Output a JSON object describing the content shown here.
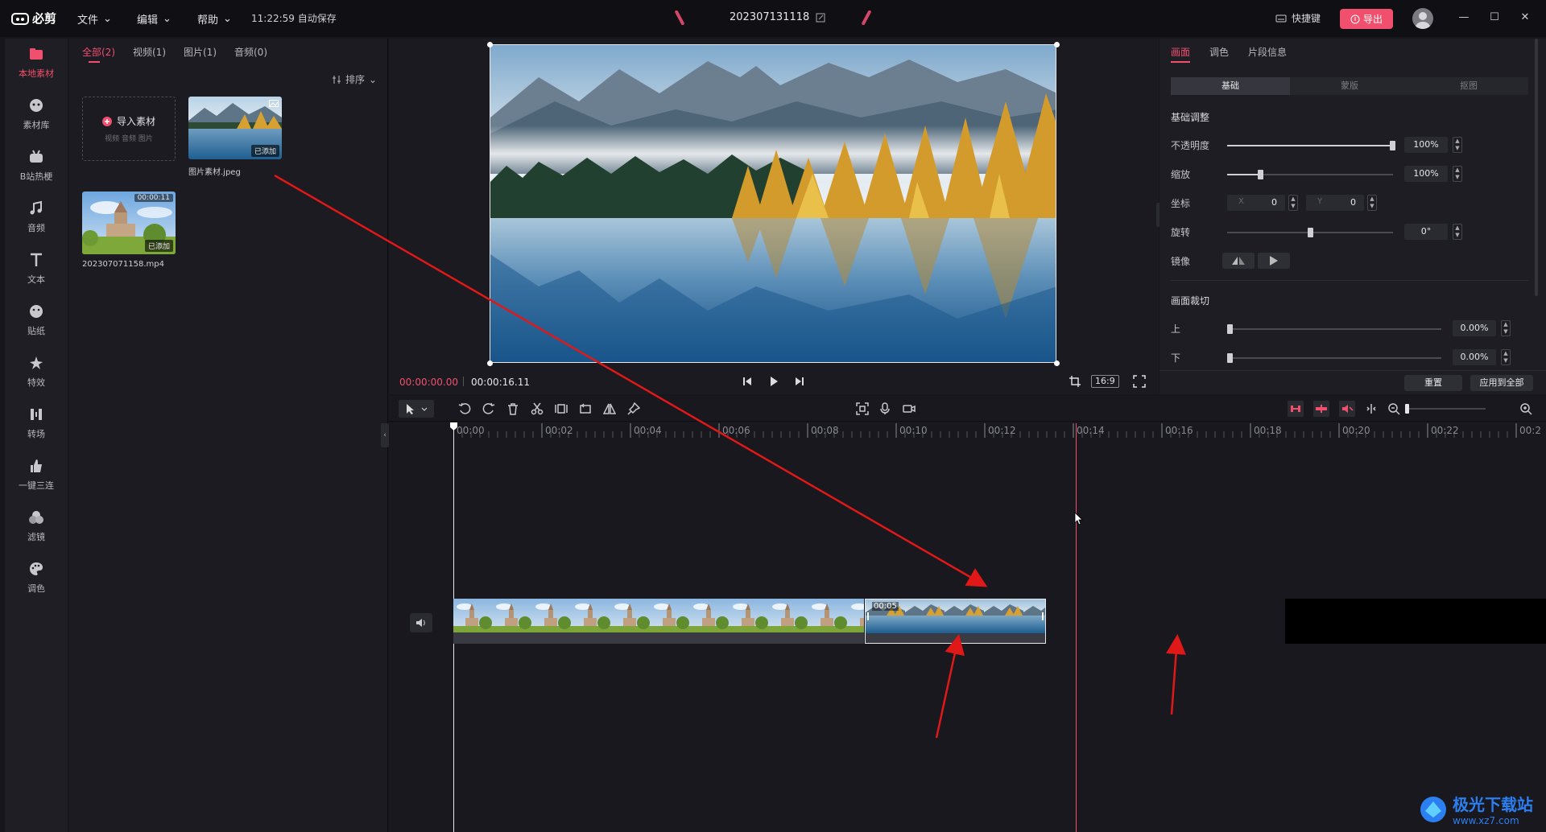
{
  "app": {
    "name": "必剪",
    "autosave": "11:22:59 自动保存",
    "project_title": "202307131118"
  },
  "menu": [
    {
      "label": "文件"
    },
    {
      "label": "编辑"
    },
    {
      "label": "帮助"
    }
  ],
  "topbar": {
    "shortcut_label": "快捷键",
    "export_label": "导出",
    "accent": "#f0506e"
  },
  "sidebar": {
    "items": [
      {
        "label": "本地素材",
        "icon": "folder-icon",
        "active": true
      },
      {
        "label": "素材库",
        "icon": "library-icon"
      },
      {
        "label": "B站热梗",
        "icon": "tv-icon"
      },
      {
        "label": "音频",
        "icon": "music-icon"
      },
      {
        "label": "文本",
        "icon": "text-icon"
      },
      {
        "label": "贴纸",
        "icon": "sticker-icon"
      },
      {
        "label": "特效",
        "icon": "effect-icon"
      },
      {
        "label": "转场",
        "icon": "transition-icon"
      },
      {
        "label": "一键三连",
        "icon": "thumb-up-icon"
      },
      {
        "label": "滤镜",
        "icon": "filter-icon"
      },
      {
        "label": "调色",
        "icon": "palette-icon"
      }
    ]
  },
  "media": {
    "tabs": [
      {
        "label": "全部(2)",
        "active": true
      },
      {
        "label": "视频(1)"
      },
      {
        "label": "图片(1)"
      },
      {
        "label": "音频(0)"
      }
    ],
    "sort_label": "排序",
    "import": {
      "label": "导入素材",
      "sub": "视频 音频 图片"
    },
    "items": [
      {
        "name": "图片素材.jpeg",
        "badge": "已添加"
      },
      {
        "name": "202307071158.mp4",
        "badge": "已添加",
        "duration": "00:00:11"
      }
    ]
  },
  "preview": {
    "current_time": "00:00:00.00",
    "total_time": "00:00:16.11",
    "ratio": "16:9"
  },
  "properties": {
    "tabs": [
      {
        "label": "画面",
        "active": true
      },
      {
        "label": "调色"
      },
      {
        "label": "片段信息"
      }
    ],
    "segments": [
      {
        "label": "基础",
        "active": true
      },
      {
        "label": "蒙版"
      },
      {
        "label": "抠图"
      }
    ],
    "basic_title": "基础调整",
    "opacity": {
      "label": "不透明度",
      "value": "100%",
      "level": 1.0
    },
    "scale": {
      "label": "缩放",
      "value": "100%",
      "level": 0.2
    },
    "position": {
      "label": "坐标",
      "x_label": "X",
      "x": "0",
      "y_label": "Y",
      "y": "0"
    },
    "rotation": {
      "label": "旋转",
      "value": "0°",
      "level": 0.5
    },
    "mirror": {
      "label": "镜像"
    },
    "crop_title": "画面裁切",
    "crop_top": {
      "label": "上",
      "value": "0.00%"
    },
    "crop_bottom": {
      "label": "下",
      "value": "0.00%"
    },
    "reset_label": "重置",
    "apply_all_label": "应用到全部"
  },
  "timeline": {
    "ruler": [
      "00:00",
      "00:02",
      "00:04",
      "00:06",
      "00:08",
      "00:10",
      "00:12",
      "00:14",
      "00:16",
      "00:18",
      "00:20",
      "00:22",
      "00:2"
    ],
    "clip_image_duration": "00:05"
  },
  "watermark": {
    "title": "极光下载站",
    "sub": "www.xz7.com"
  }
}
